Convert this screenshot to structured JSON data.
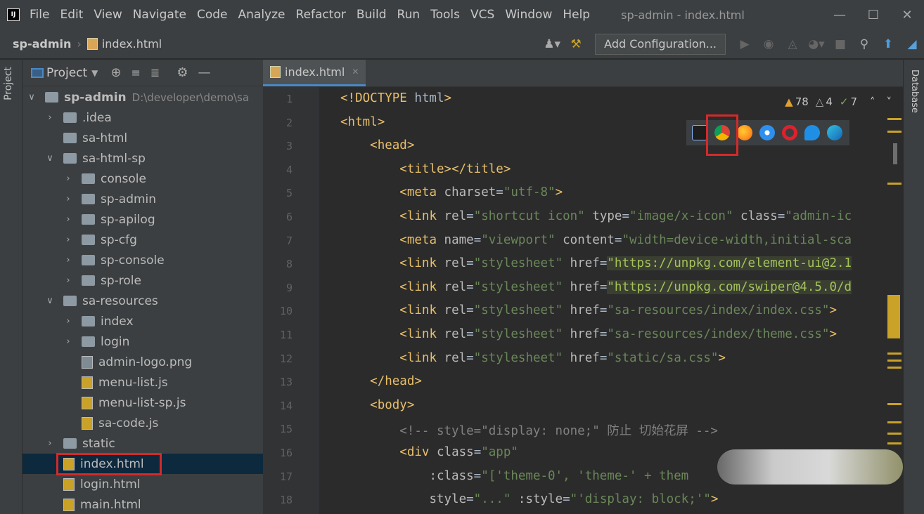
{
  "menu": {
    "items": [
      "File",
      "Edit",
      "View",
      "Navigate",
      "Code",
      "Analyze",
      "Refactor",
      "Build",
      "Run",
      "Tools",
      "VCS",
      "Window",
      "Help"
    ],
    "window_title": "sp-admin - index.html"
  },
  "navbar": {
    "project": "sp-admin",
    "file": "index.html",
    "config_label": "Add Configuration..."
  },
  "sidebar": {
    "strip_label": "Project",
    "title": "Project",
    "right_strip_label": "Database"
  },
  "tree": [
    {
      "label": "sp-admin",
      "path": "D:\\developer\\demo\\sa",
      "arrow": "v",
      "icon": "folder",
      "indent": 1,
      "bold": true
    },
    {
      "label": ".idea",
      "arrow": ">",
      "icon": "folder",
      "indent": 2
    },
    {
      "label": "sa-html",
      "arrow": "",
      "icon": "folder",
      "indent": 2
    },
    {
      "label": "sa-html-sp",
      "arrow": "v",
      "icon": "folder",
      "indent": 2
    },
    {
      "label": "console",
      "arrow": ">",
      "icon": "folder",
      "indent": 3
    },
    {
      "label": "sp-admin",
      "arrow": ">",
      "icon": "folder",
      "indent": 3
    },
    {
      "label": "sp-apilog",
      "arrow": ">",
      "icon": "folder",
      "indent": 3
    },
    {
      "label": "sp-cfg",
      "arrow": ">",
      "icon": "folder",
      "indent": 3
    },
    {
      "label": "sp-console",
      "arrow": ">",
      "icon": "folder",
      "indent": 3
    },
    {
      "label": "sp-role",
      "arrow": ">",
      "icon": "folder",
      "indent": 3
    },
    {
      "label": "sa-resources",
      "arrow": "v",
      "icon": "folder",
      "indent": 2
    },
    {
      "label": "index",
      "arrow": ">",
      "icon": "folder",
      "indent": 3
    },
    {
      "label": "login",
      "arrow": ">",
      "icon": "folder",
      "indent": 3
    },
    {
      "label": "admin-logo.png",
      "arrow": "",
      "icon": "png",
      "indent": 3
    },
    {
      "label": "menu-list.js",
      "arrow": "",
      "icon": "js",
      "indent": 3
    },
    {
      "label": "menu-list-sp.js",
      "arrow": "",
      "icon": "js",
      "indent": 3
    },
    {
      "label": "sa-code.js",
      "arrow": "",
      "icon": "js",
      "indent": 3
    },
    {
      "label": "static",
      "arrow": ">",
      "icon": "folder",
      "indent": 2
    },
    {
      "label": "index.html",
      "arrow": "",
      "icon": "html",
      "indent": 2,
      "selected": true
    },
    {
      "label": "login.html",
      "arrow": "",
      "icon": "html",
      "indent": 2
    },
    {
      "label": "main.html",
      "arrow": "",
      "icon": "html",
      "indent": 2
    }
  ],
  "editor": {
    "tab_label": "index.html",
    "inspections": {
      "warnings": "78",
      "weak_warnings": "4",
      "typos": "7"
    },
    "line_numbers": [
      "1",
      "2",
      "3",
      "4",
      "5",
      "6",
      "7",
      "8",
      "9",
      "10",
      "11",
      "12",
      "13",
      "14",
      "15",
      "16",
      "17",
      "18"
    ],
    "lines": [
      "<!DOCTYPE html>",
      "<html>",
      "    <head>",
      "        <title></title>",
      "        <meta charset=\"utf-8\">",
      "        <link rel=\"shortcut icon\" type=\"image/x-icon\" class=\"admin-ic",
      "        <meta name=\"viewport\" content=\"width=device-width,initial-sca",
      "        <link rel=\"stylesheet\" href=\"https://unpkg.com/element-ui@2.1",
      "        <link rel=\"stylesheet\" href=\"https://unpkg.com/swiper@4.5.0/d",
      "        <link rel=\"stylesheet\" href=\"sa-resources/index/index.css\">",
      "        <link rel=\"stylesheet\" href=\"sa-resources/index/theme.css\">",
      "        <link rel=\"stylesheet\" href=\"static/sa.css\">",
      "    </head>",
      "    <body>",
      "        <!-- style=\"display: none;\" 防止 切始花屏 -->",
      "        <div class=\"app\"",
      "            :class=\"['theme-0', 'theme-' + them",
      "            style=\"...\" :style=\"'display: block;'\">"
    ]
  },
  "browser_icons": [
    "intellij-preview-icon",
    "chrome-icon",
    "firefox-icon",
    "safari-icon",
    "opera-icon",
    "ie-icon",
    "edge-icon"
  ]
}
